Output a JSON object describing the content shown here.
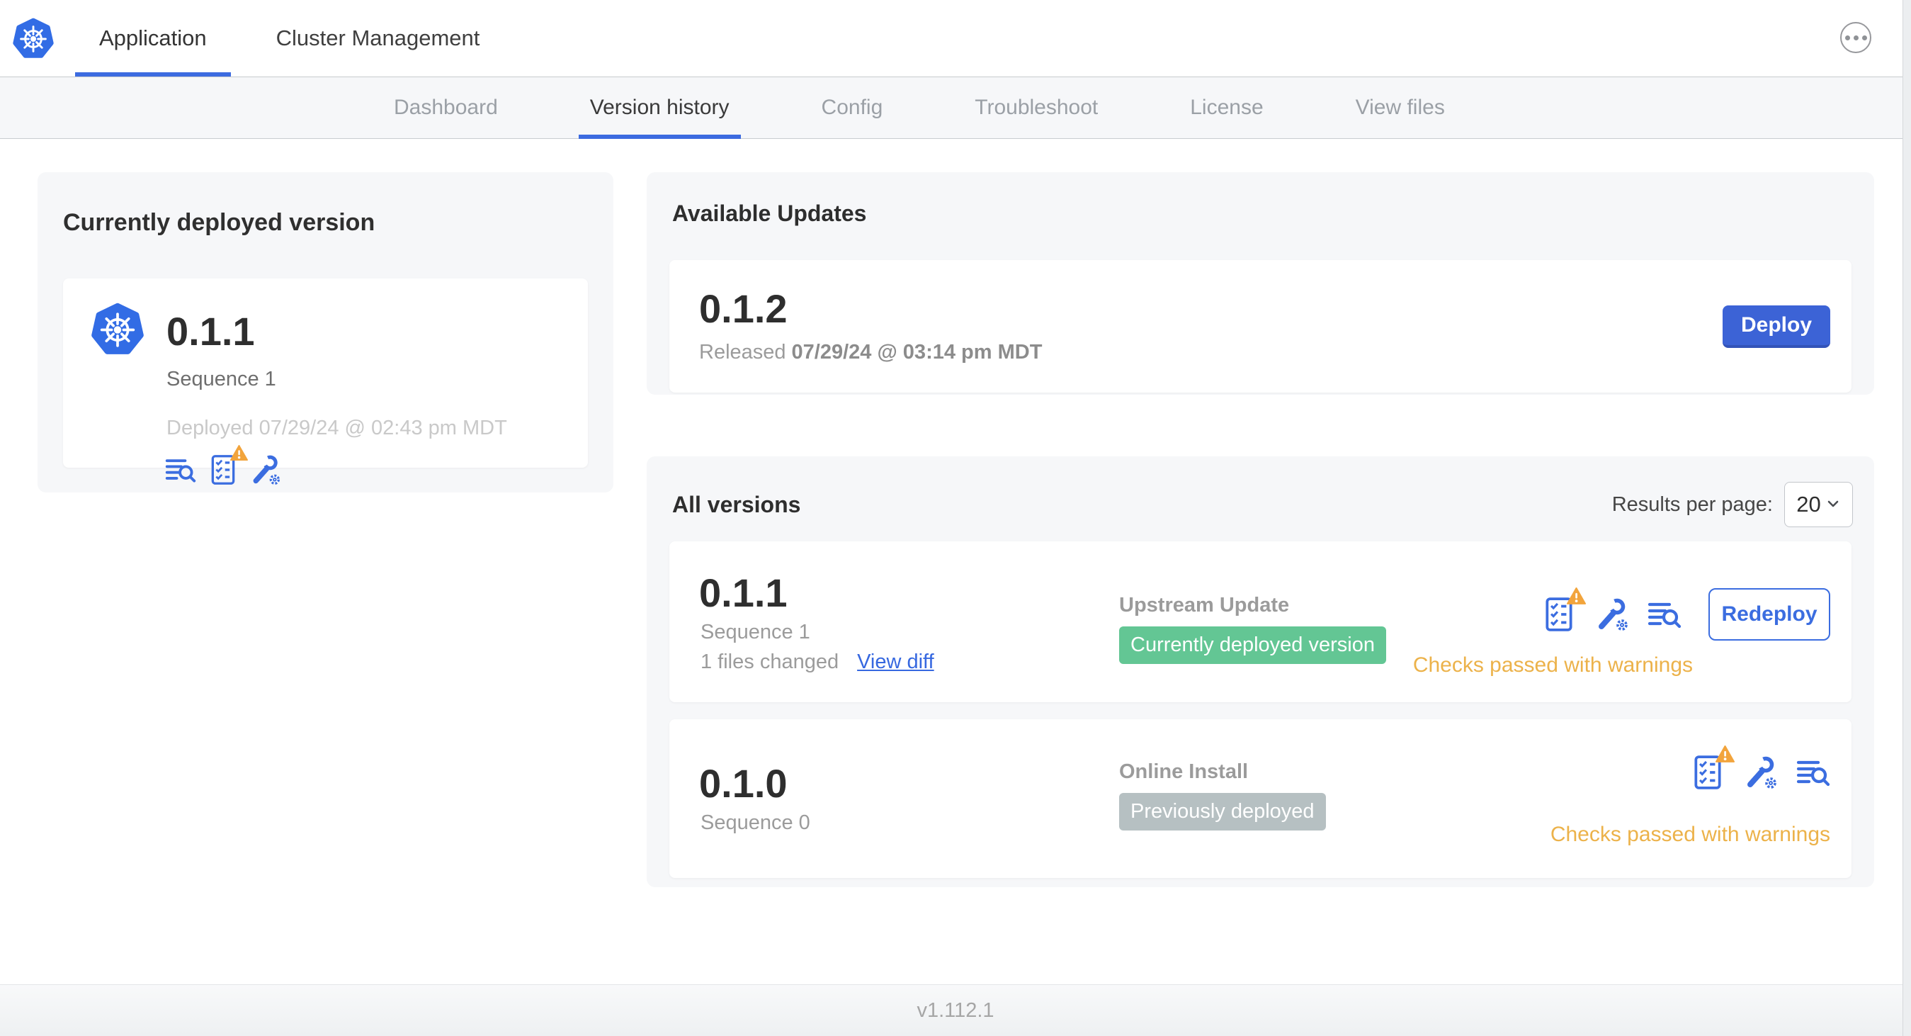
{
  "header": {
    "tabs": [
      {
        "label": "Application",
        "active": true
      },
      {
        "label": "Cluster Management",
        "active": false
      }
    ]
  },
  "subnav": {
    "tabs": [
      {
        "label": "Dashboard",
        "active": false
      },
      {
        "label": "Version history",
        "active": true
      },
      {
        "label": "Config",
        "active": false
      },
      {
        "label": "Troubleshoot",
        "active": false
      },
      {
        "label": "License",
        "active": false
      },
      {
        "label": "View files",
        "active": false
      }
    ]
  },
  "deployed": {
    "title": "Currently deployed version",
    "version": "0.1.1",
    "sequence": "Sequence 1",
    "deployed_at": "Deployed 07/29/24 @ 02:43 pm MDT"
  },
  "updates": {
    "title": "Available Updates",
    "version": "0.1.2",
    "released_label": "Released",
    "released_date": "07/29/24 @ 03:14 pm MDT",
    "deploy_label": "Deploy"
  },
  "versions": {
    "title": "All versions",
    "results_per_page_label": "Results per page:",
    "results_per_page_value": "20",
    "rows": [
      {
        "version": "0.1.1",
        "sequence": "Sequence 1",
        "files_changed": "1 files changed",
        "view_diff_label": "View diff",
        "source": "Upstream Update",
        "badge": "Currently deployed version",
        "badge_color": "#63c694",
        "checks": "Checks passed with warnings",
        "action_label": "Redeploy"
      },
      {
        "version": "0.1.0",
        "sequence": "Sequence 0",
        "source": "Online Install",
        "badge": "Previously deployed",
        "badge_color": "#b6c0c2",
        "checks": "Checks passed with warnings"
      }
    ]
  },
  "footer": {
    "app_version": "v1.112.1"
  },
  "icons": [
    "kubernetes-logo",
    "ellipsis-icon",
    "logs-icon",
    "preflight-checks-icon",
    "warning-icon",
    "config-icon",
    "chevron-down-icon"
  ],
  "colors": {
    "accent_blue": "#3b6de0",
    "deploy_button_blue": "#3c63d6",
    "k8s_logo_blue": "#326ce5",
    "success_green": "#63c694",
    "muted_badge_gray": "#b6c0c2",
    "warning_text": "#ecb24a",
    "warning_triangle": "#f2a43c"
  }
}
